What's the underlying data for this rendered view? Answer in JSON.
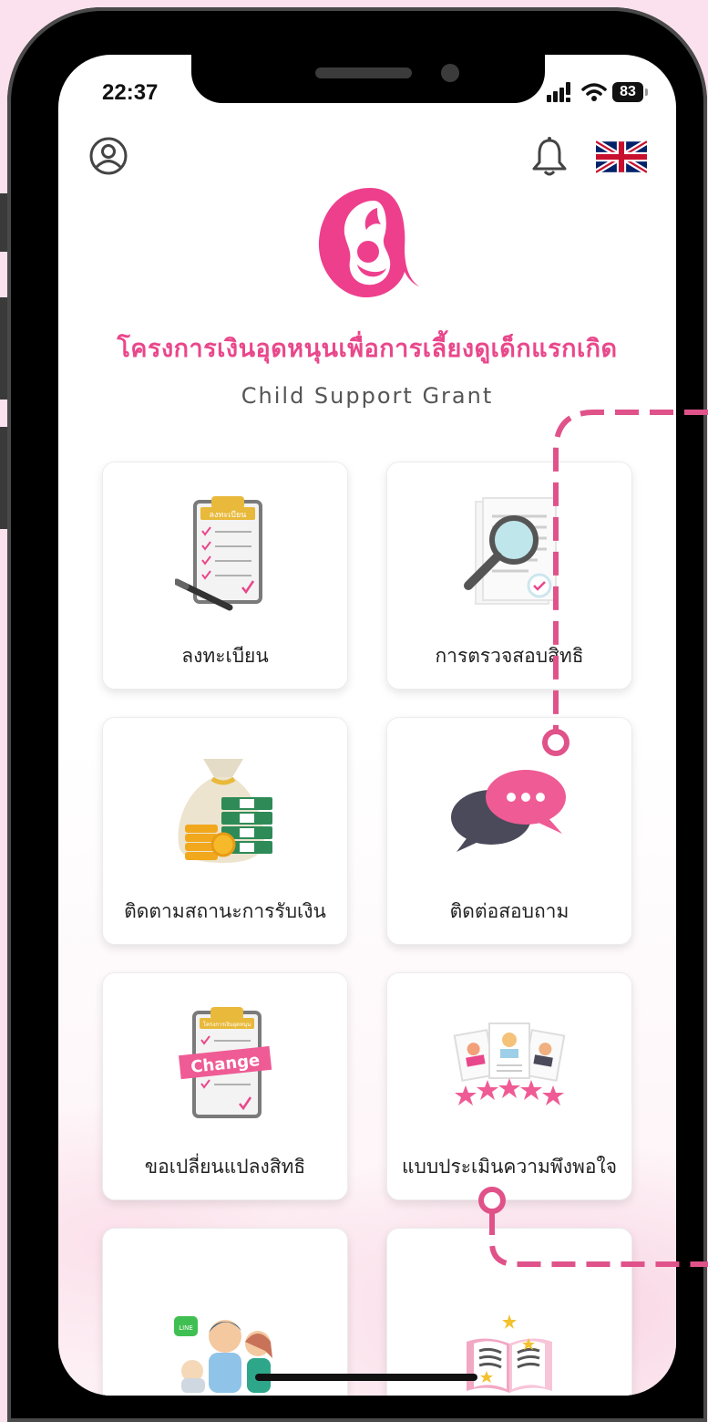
{
  "status_bar": {
    "time": "22:37",
    "battery": "83"
  },
  "header": {
    "language": "EN (UK flag)"
  },
  "app": {
    "title_th": "โครงการเงินอุดหนุนเพื่อการเลี้ยงดูเด็กแรกเกิด",
    "title_en": "Child Support Grant"
  },
  "menu": [
    {
      "label": "ลงทะเบียน",
      "icon": "register-clipboard-icon",
      "icon_text": "ลงทะเบียน"
    },
    {
      "label": "การตรวจสอบสิทธิ",
      "icon": "magnifier-document-icon"
    },
    {
      "label": "ติดตามสถานะการรับเงิน",
      "icon": "money-bag-icon"
    },
    {
      "label": "ติดต่อสอบถาม",
      "icon": "chat-bubbles-icon"
    },
    {
      "label": "ขอเปลี่ยนแปลงสิทธิ",
      "icon": "change-clipboard-icon",
      "icon_text": "Change",
      "icon_subtext": "โครงการเงินอุดหนุน"
    },
    {
      "label": "แบบประเมินความพึงพอใจ",
      "icon": "rating-stars-icon"
    },
    {
      "label": "",
      "icon": "family-line-icon"
    },
    {
      "label": "",
      "icon": "open-book-icon"
    }
  ],
  "colors": {
    "brand_pink": "#e9478b",
    "dash_pink": "#e0528a",
    "background": "#fbe1ee"
  }
}
